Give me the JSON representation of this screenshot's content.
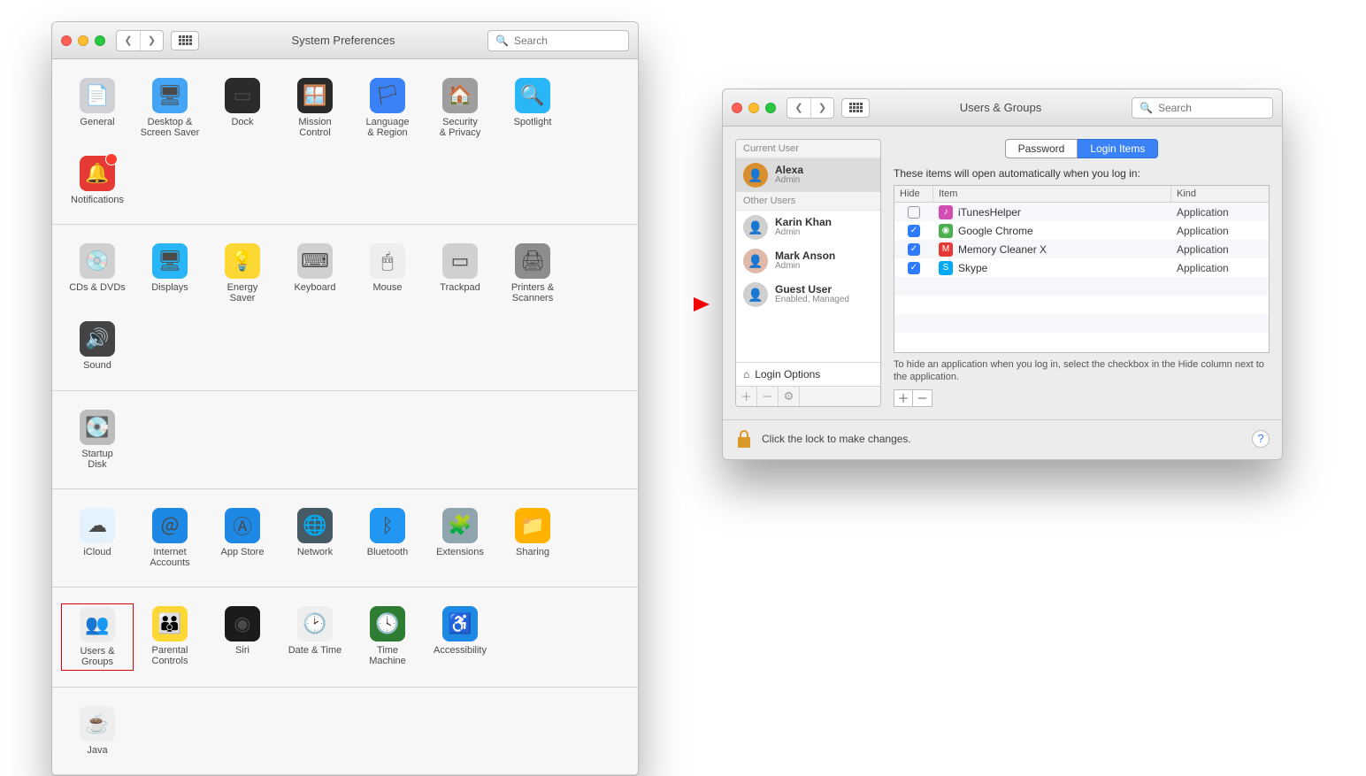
{
  "window1": {
    "title": "System Preferences",
    "search_placeholder": "Search",
    "sections": [
      [
        {
          "key": "general",
          "label": "General",
          "color": "#cfd1d4",
          "emoji": "📄"
        },
        {
          "key": "desktop",
          "label": "Desktop &\nScreen Saver",
          "color": "#42a5f5",
          "emoji": "🖥"
        },
        {
          "key": "dock",
          "label": "Dock",
          "color": "#2b2b2b",
          "emoji": "▭"
        },
        {
          "key": "mission",
          "label": "Mission\nControl",
          "color": "#2b2b2b",
          "emoji": "🪟"
        },
        {
          "key": "language",
          "label": "Language\n& Region",
          "color": "#3b82f6",
          "emoji": "🏳"
        },
        {
          "key": "security",
          "label": "Security\n& Privacy",
          "color": "#9e9e9e",
          "emoji": "🏠"
        },
        {
          "key": "spotlight",
          "label": "Spotlight",
          "color": "#29b6f6",
          "emoji": "🔍"
        },
        {
          "key": "notifications",
          "label": "Notifications",
          "color": "#e53935",
          "emoji": "🔔",
          "badge": true
        }
      ],
      [
        {
          "key": "cddvd",
          "label": "CDs & DVDs",
          "color": "#d0d0d0",
          "emoji": "💿"
        },
        {
          "key": "displays",
          "label": "Displays",
          "color": "#29b6f6",
          "emoji": "🖥"
        },
        {
          "key": "energy",
          "label": "Energy\nSaver",
          "color": "#fdd835",
          "emoji": "💡"
        },
        {
          "key": "keyboard",
          "label": "Keyboard",
          "color": "#d0d0d0",
          "emoji": "⌨"
        },
        {
          "key": "mouse",
          "label": "Mouse",
          "color": "#eeeeee",
          "emoji": "🖱"
        },
        {
          "key": "trackpad",
          "label": "Trackpad",
          "color": "#d0d0d0",
          "emoji": "▭"
        },
        {
          "key": "printers",
          "label": "Printers &\nScanners",
          "color": "#8d8d8d",
          "emoji": "🖨"
        },
        {
          "key": "sound",
          "label": "Sound",
          "color": "#444",
          "emoji": "🔊"
        }
      ],
      [
        {
          "key": "startup",
          "label": "Startup\nDisk",
          "color": "#bdbdbd",
          "emoji": "💽"
        }
      ],
      [
        {
          "key": "icloud",
          "label": "iCloud",
          "color": "#e3f2fd",
          "emoji": "☁"
        },
        {
          "key": "internet",
          "label": "Internet\nAccounts",
          "color": "#1e88e5",
          "emoji": "＠"
        },
        {
          "key": "appstore",
          "label": "App Store",
          "color": "#1e88e5",
          "emoji": "Ⓐ"
        },
        {
          "key": "network",
          "label": "Network",
          "color": "#455a64",
          "emoji": "🌐"
        },
        {
          "key": "bluetooth",
          "label": "Bluetooth",
          "color": "#2196f3",
          "emoji": "ᛒ"
        },
        {
          "key": "extensions",
          "label": "Extensions",
          "color": "#90a4ae",
          "emoji": "🧩"
        },
        {
          "key": "sharing",
          "label": "Sharing",
          "color": "#ffb300",
          "emoji": "📁"
        }
      ],
      [
        {
          "key": "users",
          "label": "Users &\nGroups",
          "color": "#ececec",
          "emoji": "👥",
          "highlight": true
        },
        {
          "key": "parental",
          "label": "Parental\nControls",
          "color": "#fdd835",
          "emoji": "👪"
        },
        {
          "key": "siri",
          "label": "Siri",
          "color": "#1b1b1b",
          "emoji": "◉"
        },
        {
          "key": "datetime",
          "label": "Date & Time",
          "color": "#eeeeee",
          "emoji": "🕑"
        },
        {
          "key": "timemachine",
          "label": "Time\nMachine",
          "color": "#2e7d32",
          "emoji": "🕓"
        },
        {
          "key": "accessibility",
          "label": "Accessibility",
          "color": "#1e88e5",
          "emoji": "♿"
        }
      ],
      [
        {
          "key": "java",
          "label": "Java",
          "color": "#eeeeee",
          "emoji": "☕"
        }
      ]
    ]
  },
  "window2": {
    "title": "Users & Groups",
    "search_placeholder": "Search",
    "tabs": {
      "password": "Password",
      "login": "Login Items",
      "active": "login"
    },
    "sidebar": {
      "current_header": "Current User",
      "other_header": "Other Users",
      "users": [
        {
          "name": "Alexa",
          "role": "Admin",
          "selected": true,
          "avatarColor": "#d98f2e"
        },
        {
          "name": "Karin Khan",
          "role": "Admin",
          "selected": false,
          "avatarColor": "#cfcfcf"
        },
        {
          "name": "Mark Anson",
          "role": "Admin",
          "selected": false,
          "avatarColor": "#e0b9a8"
        },
        {
          "name": "Guest User",
          "role": "Enabled, Managed",
          "selected": false,
          "avatarColor": "#cfcfcf"
        }
      ],
      "login_options": "Login Options"
    },
    "login_items": {
      "heading": "These items will open automatically when you log in:",
      "columns": {
        "hide": "Hide",
        "item": "Item",
        "kind": "Kind"
      },
      "rows": [
        {
          "hide": false,
          "name": "iTunesHelper",
          "kind": "Application",
          "iconColor": "#d24db0",
          "iconText": "♪"
        },
        {
          "hide": true,
          "name": "Google Chrome",
          "kind": "Application",
          "iconColor": "#4caf50",
          "iconText": "◉"
        },
        {
          "hide": true,
          "name": "Memory Cleaner X",
          "kind": "Application",
          "iconColor": "#e53935",
          "iconText": "M"
        },
        {
          "hide": true,
          "name": "Skype",
          "kind": "Application",
          "iconColor": "#03a9f4",
          "iconText": "S"
        }
      ],
      "hint": "To hide an application when you log in, select the checkbox in the Hide column next to the application."
    },
    "lock_text": "Click the lock to make changes."
  }
}
